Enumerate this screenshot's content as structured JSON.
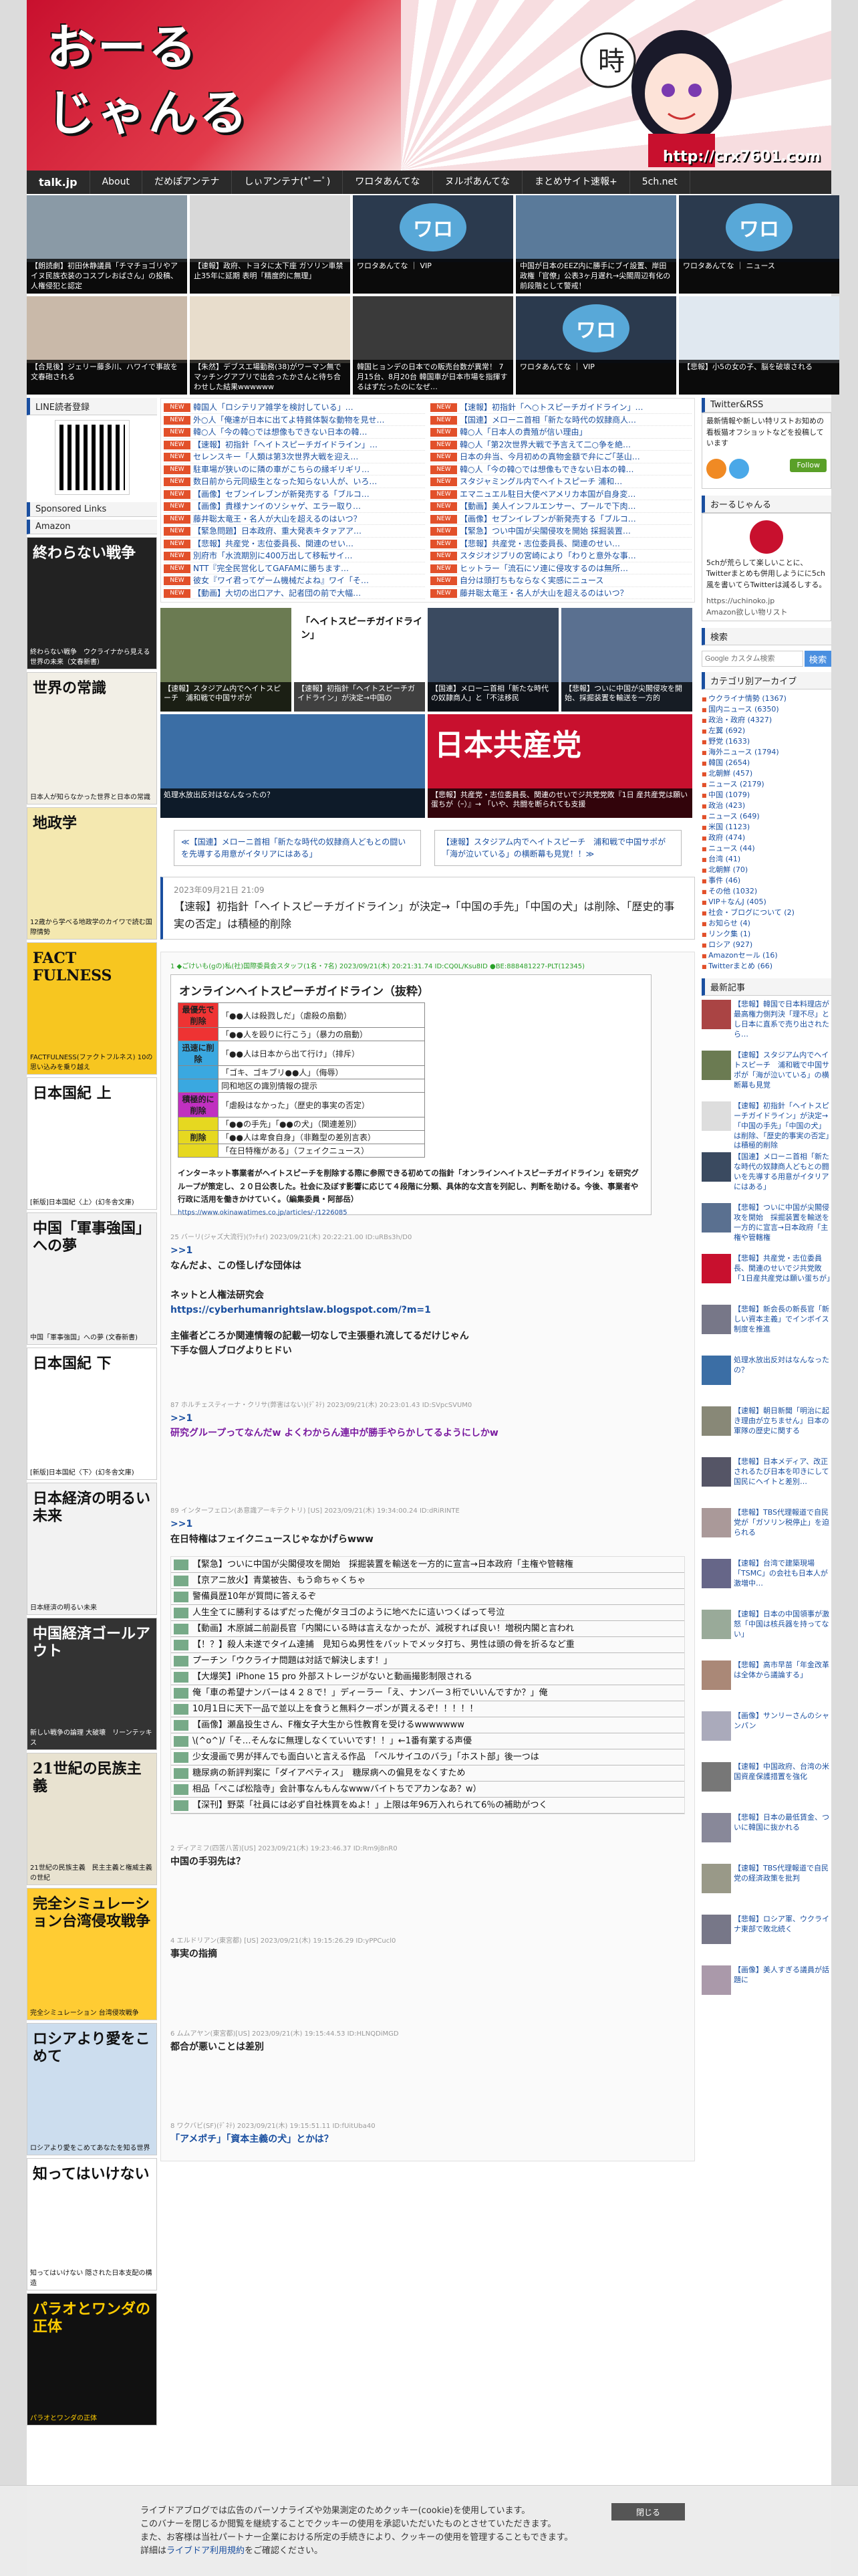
{
  "header": {
    "logo_line1": "おーる",
    "logo_line2": "じゃんる",
    "url": "http://crx7601.com",
    "kanji": "時"
  },
  "nav": [
    "talk.jp",
    "About",
    "だめぽアンテナ",
    "しぃアンテナ(*ﾟーﾟ)",
    "ワロタあんてな",
    "ヌルポあんてな",
    "まとめサイト速報+",
    "5ch.net"
  ],
  "thumbs": [
    {
      "cap": "【朗読劇】初田休静議員「チマチョゴリやアイヌ民族衣装のコスプレおばさん」の投稿、人権侵犯と認定",
      "img": "#8a9aa6"
    },
    {
      "cap": "【速報】政府、トヨタに太下座 ガソリン車禁止35年に延期 表明「精度的に無理」",
      "img": "#d8d8d8"
    },
    {
      "cap": "ワロタあんてな ｜ VIP",
      "img": "#2b3a4e",
      "logo": "ワロ"
    },
    {
      "cap": "中国が日本のEEZ内に勝手にブイ設置、岸田政権「官僚」公表3ヶ月遅れ→尖閣周辺有化の前段階として警戒！",
      "img": "#5a7a9a"
    },
    {
      "cap": "ワロタあんてな ｜ ニュース",
      "img": "#2b3a4e",
      "logo": "ワロ"
    },
    {
      "cap": "【合見後】ジェリー藤多川、ハワイで事故を文春砲される",
      "img": "#c9b9a9"
    },
    {
      "cap": "【朱然】デブスエ場勤務(38)がワーマン無でマッチングアプリで出会ったかさんと待ち合わせした結果wwwwww",
      "img": "#e8ddcc"
    },
    {
      "cap": "韓国ヒョンデの日本での販売台数が異常！ 7月15台、8月20台 韓国車が日本市場を指揮するはずだったのになぜ…",
      "img": "#3a3a3a"
    },
    {
      "cap": "ワロタあんてな ｜ VIP",
      "img": "#2b3a4e",
      "logo": "ワロ"
    },
    {
      "cap": "【悲報】小5の女の子、脳を破壊される",
      "img": "#e0e8f0"
    }
  ],
  "left_sidebar": {
    "line_title": "LINE読者登録",
    "sponsored_title": "Sponsored Links",
    "amazon_title": "Amazon",
    "books": [
      {
        "title": "終わらない戦争",
        "sub": "終わらない戦争　ウクライナから見える世界の未来（文春新書）",
        "bg": "#222",
        "fg": "#fff"
      },
      {
        "title": "世界の常識",
        "sub": "日本人が知らなかった世界と日本の常識",
        "bg": "#f2efe6",
        "fg": "#111"
      },
      {
        "title": "地政学",
        "sub": "12歳から学べる地政学のカイワで読む国際情勢",
        "bg": "#f4e8b0",
        "fg": "#111"
      },
      {
        "title": "FACT FULNESS",
        "sub": "FACTFULNESS(ファクトフルネス) 10の思い込みを乗り越え",
        "bg": "#f7c620",
        "fg": "#111"
      },
      {
        "title": "日本国紀 上",
        "sub": "[新版]日本国紀〈上〉(幻冬舎文庫)",
        "bg": "#fff",
        "fg": "#111"
      },
      {
        "title": "中国「軍事強国」への夢",
        "sub": "中国「軍事強国」への夢 (文春新書)",
        "bg": "#f2f2f2",
        "fg": "#111"
      },
      {
        "title": "日本国紀 下",
        "sub": "[新版]日本国紀〈下〉(幻冬舎文庫)",
        "bg": "#fff",
        "fg": "#111"
      },
      {
        "title": "日本経済の明るい未来",
        "sub": "日本経済の明るい未来",
        "bg": "#f2f2f2",
        "fg": "#111"
      },
      {
        "title": "中国経済ゴールアウト",
        "sub": "新しい戦争の論理 大破壊　リーンテッキス",
        "bg": "#333",
        "fg": "#fff"
      },
      {
        "title": "21世紀の民族主義",
        "sub": "21世紀の民族主義　民主主義と権威主義の世紀",
        "bg": "#e8e2d0",
        "fg": "#111"
      },
      {
        "title": "完全シミュレーション台湾侵攻戦争",
        "sub": "完全シミュレーション 台湾侵攻戦争",
        "bg": "#ffcc33",
        "fg": "#111"
      },
      {
        "title": "ロシアより愛をこめて",
        "sub": "ロシアより愛をこめてあなたを知る世界",
        "bg": "#ccddee",
        "fg": "#111"
      },
      {
        "title": "知ってはいけない",
        "sub": "知ってはいけない 隠された日本支配の構造",
        "bg": "#fff",
        "fg": "#111"
      },
      {
        "title": "パラオとワンダの正体",
        "sub": "パラオとワンダの正体",
        "bg": "#111",
        "fg": "#ffcc00"
      }
    ]
  },
  "news_left": [
    "韓国人「ロシテリア雑学を検討している」…",
    "外○人「俺達が日本に出てよ特貧体製な動物を見せ…",
    "韓○人「今の韓○では想像もできない日本の韓…",
    "【速報】初指針「ヘイトスピーチガイドライン」…",
    "セレンスキー「人類は第3次世界大戦を迎え…",
    "駐車場が狭いのに隣の車がこちらの縁ギリギリ…",
    "数日前から元同級生となった知らない人が、いろ…",
    "【画像】セブンイレブンが新発売する「ブルコ…",
    "【画像】貴様ナンイのソシャゲ、エラー取り…",
    "藤井聡太竜王・名人が大山を超えるのはいつ？",
    "【緊急問題】日本政府、重大発表キタァアア…",
    "【悲報】共産党・志位委員長、関連のせい…",
    "別府市「水流期別に400万出して移転サイ…",
    "NTT『完全民営化してGAFAMに勝ちます…",
    "彼女『ワイ君ってゲーム機械だよね』ワイ「そ…",
    "【動画】大切の出口アナ、記者団の前で大幅…"
  ],
  "news_right": [
    "【速報】初指針「ヘ○トスピーチガイドライン」…",
    "【国連】メローニ首相「新たな時代の奴隷商人…",
    "韓○人「日本人の貴殖が信い理由」",
    "韓○人「第2次世界大戦で予言えて二○争を絶…",
    "日本の弁当、今月初めの真物金額で弁にご｢茎山…",
    "韓○人「今の韓○では想像もできない日本の韓…",
    "スタジャミングル内でヘイトスピーチ 浦和…",
    "エマニュエル駐日大使ペアメリカ本国が自身変…",
    "【動画】美人インフルエンサー、プールで下肉…",
    "【画像】セブンイレブンが新発売する「ブルコ…",
    "【緊急】つい中国が尖閣侵攻を開始 採掘装置…",
    "【悲報】共産党・志位委員長、関連のせい…",
    "スタジオジブリの宮崎により「わりと意外な事…",
    "ヒットラー「流石にソ連に侵攻するのは無所…",
    "自分は頭打ちもならなく実感にニュース",
    "藤井聡太竜王・名人が大山を超えるのはいつ？"
  ],
  "pics": [
    {
      "cap": "【速報】スタジアム内でヘイトスピーチ　浦和戦で中国サポが",
      "bg": "#6b7b52"
    },
    {
      "cap": "【速報】初指針「ヘイトスピーチガイドライン」が決定→中国の",
      "bg": "#fff",
      "doc": "「ヘイトスピーチガイドライン」"
    },
    {
      "cap": "【国連】メローニ首相「新たな時代の奴隷商人」と「不法移民",
      "bg": "#3a4a60"
    },
    {
      "cap": "【悲報】ついに中国が尖閣侵攻を開始、採掘装置を輸送を一方的",
      "bg": "#5a7090"
    },
    {
      "cap": "処理水放出反対はなんなったの？",
      "bg": "#3b6ea5"
    },
    {
      "cap": "【悲報】共産党・志位委員長、関連のせいでジ共党党敗『1日 産共産党は願い蛋ちが（ｰ）』→ 「いや、共闘を断られても支援",
      "bg": "#c8102e",
      "doc": "日本共産党"
    }
  ],
  "pagination": {
    "prev": "≪【国連】メローニ首相「新たな時代の奴隷商人どもとの闘いを先導する用意がイタリアにはある」",
    "next": "【速報】スタジアム内でヘイトスピーチ　浦和戦で中国サポが「海が泣いている」の横断幕も見覚！！≫"
  },
  "article": {
    "date": "2023年09月21日 21:09",
    "title": "【速報】初指針「ヘイトスピーチガイドライン」が決定→「中国の手先」「中国の犬」は削除、「歴史的事実の否定」は積極的削除"
  },
  "post1": {
    "header": "1 ◆ごけいも(gの)私(社)国際委員会スタッフ(1名・7名) 2023/09/21(木) 20:21:31.74 ID:CQ0L/Ksu8ID ●BE:888481227-PLT(12345)",
    "screenshot": {
      "title": "オンラインヘイトスピーチガイドライン（抜粋）",
      "rows": [
        {
          "cat": "最優先で削除",
          "text": "「●●人は殺戮しだ」（虐殺の扇動）",
          "color": "#e33"
        },
        {
          "cat": "",
          "text": "「●●人を殴りに行こう」（暴力の扇動）",
          "color": "#e33"
        },
        {
          "cat": "迅速に削除",
          "text": "「●●人は日本から出て行け」（排斥）",
          "color": "#3aa8e0"
        },
        {
          "cat": "",
          "text": "「ゴキ、ゴキブリ●●人」（侮辱）",
          "color": "#3aa8e0"
        },
        {
          "cat": "",
          "text": "同和地区の識別情報の提示",
          "color": "#3aa8e0"
        },
        {
          "cat": "積極的に削除",
          "text": "「虐殺はなかった」（歴史的事実の否定）",
          "color": "#c030c0"
        },
        {
          "cat": "",
          "text": "「●●の手先」「●●の犬」（関連差別）",
          "color": "#e6d820"
        },
        {
          "cat": "削除",
          "text": "「●●人は卑食自身」（非難型の差別言表）",
          "color": "#e6d820"
        },
        {
          "cat": "",
          "text": "「在日特権がある」（フェイクニュース）",
          "color": "#e6d820"
        }
      ],
      "body": "インターネット事業者がヘイトスピーチを削除する際に参照できる初めての指針「オンラインヘイトスピーチガイドライン」を研究グループが策定し、２０日公表した。社会に及ぼす影響に応じて４段階に分類、具体的な文言を列記し、判断を助ける。今後、事業者や行政に活用を働きかけていく。（編集委員・阿部岳）",
      "link": "https://www.okinawatimes.co.jp/articles/-/1226085"
    }
  },
  "reply2": {
    "header": "25 バーリ(ジャズ大流行)(ﾜｯﾁｮｲ) 2023/09/21(木) 20:22:21.00 ID:uRBs3h/D0",
    "anchor": ">>1",
    "lines": [
      "なんだよ、この怪しげな団体は",
      "",
      "ネットと人権法研究会"
    ],
    "url": "https://cyberhumanrightslaw.blogspot.com/?m=1",
    "lines2": [
      "主催者どころか関連情報の記載一切なしで主張垂れ流してるだけじゃん",
      "下手な個人ブログよりヒドい"
    ]
  },
  "reply3": {
    "header": "87 ホルチェスティーナ・クリサ(弊害はない)(ﾃﾞﾈﾃ) 2023/09/21(木) 20:23:01.43 ID:SVpcSVUM0",
    "anchor": ">>1",
    "text": "研究グループってなんだw よくわからん連中が勝手やらかしてるようにしかw"
  },
  "reply4": {
    "header": "89 インターフェロン(あ意識アーキテクトリ) [US] 2023/09/21(木) 19:34:00.24 ID:dRiRINTE",
    "anchor": ">>1",
    "text": "在日特権はフェイクニュースじゃなかげらwww"
  },
  "headlines": [
    "【緊急】ついに中国が尖閣侵攻を開始　採掘装置を輸送を一方的に宣言→日本政府「主権や管轄権",
    "【京アニ放火】青葉被告、もう命ちゃくちゃ",
    "警備員歴10年が質問に答えるぞ",
    "人生全てに勝利するはずだった俺がタヨゴのように地べたに這いつくばって号泣",
    "【動画】木原誠二前副長官「内閣にいる時は言えなかったが、減税すれば良い！増税内閣と言われ",
    "【！？】殺人未遂でタイム達捕　見知らぬ男性をバットでメッタ打ち、男性は頭の骨を折るなど重",
    "プーチン「ウクライナ問題は対話で解決します！」",
    "【大爆笑】iPhone 15 pro 外部ストレージがないと動画撮影制限される",
    "俺「車の希望ナンバーは４２８で！」ディーラー「え、ナンバー３桁でいいんですか？」俺",
    "10月1日に天下一品で並以上を食うと無料クーポンが貰えるぞ！！！！！",
    "【画像】瀬畠投生さん、F権女子大生から性教育を受けるwwwwwww",
    "\\(^o^)/「そ…そんなに無理しなくていいです！！」←1番有業する声優",
    "少女漫画で男が拝んでも面白いと言える作品　「ベルサイユのバラ」「ホスト部」後一つは",
    "糖尿病の新評判案に「ダイアペティス」　糖尿病への偏見をなくすため",
    "相品「ぺこぱ松陰寺」会計事なんもんなwwwバイトちでアカンなあ？w）",
    "【深刊】野菜「社員には必ず自社株買をぬよ！」上限は年96万入れられて6％の補助がつく"
  ],
  "reply5": {
    "header": "2 ディアミフ(四苦八苦)[US] 2023/09/21(木) 19:23:46.37 ID:Rm9j8nR0",
    "text": "中国の手羽先は？"
  },
  "reply6": {
    "header": "4 エルドリアン(東宮都) [US] 2023/09/21(木) 19:15:26.29 ID:yPPCucl0",
    "text": "事実の指摘"
  },
  "reply7": {
    "header": "6 ムムアヤン(東宮都)[US] 2023/09/21(木) 19:15:44.53 ID:HLNQDiMGD",
    "text": "都合が悪いことは差別"
  },
  "reply8": {
    "header": "8 ワクバビ(SF)(ﾃﾞﾈﾃ) 2023/09/21(木) 19:15:51.11 ID:fUitUba40",
    "text": "「アメポチ」「資本主義の犬」とかは？"
  },
  "right_sidebar": {
    "twitter_title": "Twitter&RSS",
    "twitter_text": "最新情報や新しい特リストお知めの看板猫オフショットなどを投稿しています",
    "follow": "Follow",
    "author_title": "おーるじゃんる",
    "author_text": "5chが荒らして楽しいことに、Twitterまとめも併用しようにに5ch風を書いてらTwitterは減るしする。",
    "author_link1": "https://uchinoko.jp",
    "author_link2": "Amazon欲しい物リスト",
    "search_title": "検索",
    "search_placeholder": "Google カスタム検索",
    "search_btn": "検索",
    "cat_title": "カテゴリ別アーカイブ",
    "categories": [
      "ウクライナ情勢 (1367)",
      "国内ニュース (6350)",
      "政治・政府 (4327)",
      "左翼 (692)",
      "野党 (1633)",
      "海外ニュース (1794)",
      "韓国 (2654)",
      "北朝鮮 (457)",
      "ニュース (2179)",
      "中国 (1079)",
      "政治 (423)",
      "ニュース (649)",
      "米国 (1123)",
      "政府 (474)",
      "ニュース (44)",
      "台湾 (41)",
      "北朝鮮 (70)",
      "事件 (46)",
      "その他 (1032)",
      "VIP＋なんJ (405)",
      "社会・ブログについて (2)",
      "お知らせ (4)",
      "リンク集 (1)",
      "ロシア (927)",
      "Amazonセール (16)",
      "Twitterまとめ (66)"
    ],
    "recent_title": "最新記事",
    "recent": [
      {
        "text": "【悲報】韓国で日本料理店が最高権力側判決「理不尽」とし日本に直系で売り出されたら…",
        "bg": "#a44"
      },
      {
        "text": "【速報】スタジアム内でヘイトスピーチ　浦和戦で中国サポが「海が泣いている」の横断幕も見覚",
        "bg": "#6b7b52"
      },
      {
        "text": "【速報】初指針「ヘイトスピーチガイドライン」が決定→「中国の手先」「中国の犬」は削除、「歴史的事実の否定」は積極的削除",
        "bg": "#ddd"
      },
      {
        "text": "【国連】メローニ首相「新たな時代の奴隷商人どもとの闘いを先導する用意がイタリアにはある」",
        "bg": "#3a4a60"
      },
      {
        "text": "【悲報】ついに中国が尖閣侵攻を開始　採掘装置を輸送を一方的に宣言→日本政府「主権や管轄権",
        "bg": "#5a7090"
      },
      {
        "text": "【悲報】共産党・志位委員長、関連のせいでジ共党敗「1日産共産党は願い蛋ちが」",
        "bg": "#c8102e"
      },
      {
        "text": "【悲報】新会長の新長官「新しい資本主義」でインボイス制度を推進",
        "bg": "#778"
      },
      {
        "text": "処理水放出反対はなんなったの？",
        "bg": "#3b6ea5"
      },
      {
        "text": "【速報】朝日新聞「明治に起き理由が立ちません」日本の軍隊の歴史に関する",
        "bg": "#887"
      },
      {
        "text": "【悲報】日本メディア、改正されるたび日本を叩きにして国民にヘイトと差別…",
        "bg": "#556"
      },
      {
        "text": "【悲報】TBS代理報道で自民党が「ガソリン税停止」を迫られる",
        "bg": "#a99"
      },
      {
        "text": "【速報】台湾で建築現場「TSMC」の会社も日本人が激増中…",
        "bg": "#668"
      },
      {
        "text": "【速報】日本の中国領事が激怒「中国は核兵器を持ってない」",
        "bg": "#9a9"
      },
      {
        "text": "【悲報】高市早苗「年金改革は全体から議論する」",
        "bg": "#a87"
      },
      {
        "text": "【画像】サンリーさんのシャンパン",
        "bg": "#aab"
      },
      {
        "text": "【速報】中国政府、台湾の米国資産保護措置を強化",
        "bg": "#777"
      },
      {
        "text": "【悲報】日本の最低賃金、ついに韓国に抜かれる",
        "bg": "#889"
      },
      {
        "text": "【速報】TBS代理報道で自民党の経済政策を批判",
        "bg": "#998"
      },
      {
        "text": "【悲報】ロシア軍、ウクライナ東部で敗北続く",
        "bg": "#778"
      },
      {
        "text": "【画像】美人すぎる議員が話題に",
        "bg": "#a9a"
      }
    ]
  },
  "cookie": {
    "line1": "ライブドアブログでは広告のパーソナライズや効果測定のためクッキー(cookie)を使用しています。",
    "line2": "このバナーを閉じるか閲覧を継続することでクッキーの使用を承認いただいたものとさせていただきます。",
    "line3": "また、お客様は当社パートナー企業における所定の手続きにより、クッキーの使用を管理することもできます。",
    "line4_pre": "詳細は",
    "line4_link": "ライブドア利用規約",
    "line4_post": "をご確認ください。",
    "close": "閉じる"
  }
}
